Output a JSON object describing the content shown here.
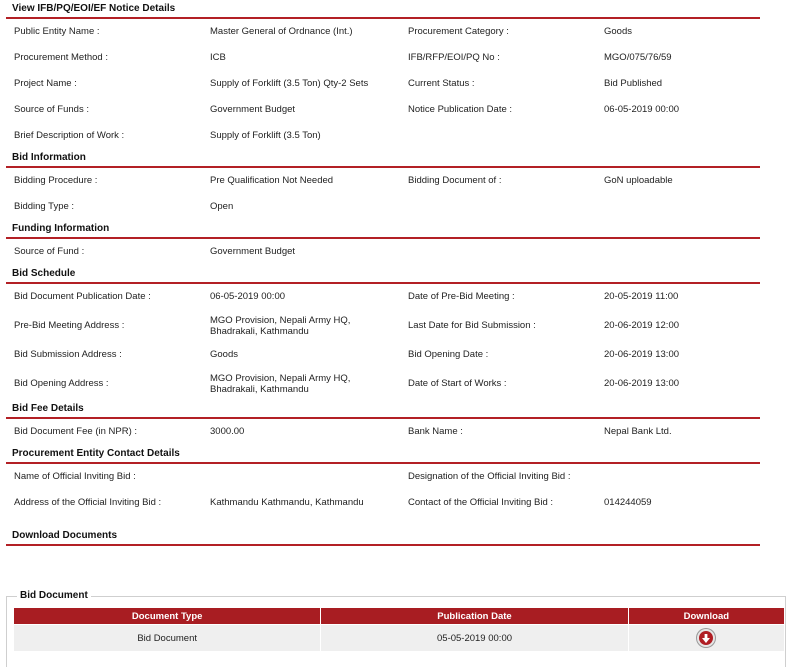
{
  "notice": {
    "title": "View IFB/PQ/EOI/EF Notice Details",
    "rows": [
      [
        "Public Entity Name :",
        "Master General of Ordnance (Int.)",
        "Procurement Category :",
        "Goods"
      ],
      [
        "Procurement Method :",
        "ICB",
        "IFB/RFP/EOI/PQ No :",
        "MGO/075/76/59"
      ],
      [
        "Project Name :",
        "Supply of Forklift (3.5 Ton) Qty-2 Sets",
        "Current Status :",
        "Bid Published"
      ],
      [
        "Source of Funds :",
        "Government Budget",
        "Notice Publication Date :",
        "06-05-2019 00:00"
      ],
      [
        "Brief Description of Work :",
        "Supply of Forklift (3.5 Ton)",
        "",
        ""
      ]
    ]
  },
  "bid_information": {
    "title": "Bid Information",
    "rows": [
      [
        "Bidding Procedure :",
        "Pre Qualification Not Needed",
        "Bidding Document of :",
        "GoN uploadable"
      ],
      [
        "Bidding Type :",
        "Open",
        "",
        ""
      ]
    ]
  },
  "funding_information": {
    "title": "Funding Information",
    "rows": [
      [
        "Source of Fund :",
        "Government Budget",
        "",
        ""
      ]
    ]
  },
  "bid_schedule": {
    "title": "Bid Schedule",
    "rows": [
      [
        "Bid Document Publication Date :",
        "06-05-2019 00:00",
        "Date of Pre-Bid Meeting :",
        "20-05-2019 11:00"
      ],
      [
        "Pre-Bid Meeting Address :",
        "MGO Provision, Nepali Army HQ, Bhadrakali, Kathmandu",
        "Last Date for Bid Submission :",
        "20-06-2019 12:00"
      ],
      [
        "Bid Submission Address :",
        "Goods",
        "Bid Opening Date :",
        "20-06-2019 13:00"
      ],
      [
        "Bid Opening Address :",
        "MGO Provision, Nepali Army HQ, Bhadrakali, Kathmandu",
        "Date of Start of Works :",
        "20-06-2019 13:00"
      ]
    ]
  },
  "bid_fee": {
    "title": "Bid Fee Details",
    "rows": [
      [
        "Bid Document Fee (in NPR) :",
        "3000.00",
        "Bank Name :",
        "Nepal Bank Ltd."
      ]
    ]
  },
  "contact": {
    "title": "Procurement Entity Contact Details",
    "rows": [
      [
        "Name of Official Inviting Bid :",
        "",
        "Designation of the Official Inviting Bid :",
        ""
      ],
      [
        "Address of the Official Inviting Bid :",
        "Kathmandu Kathmandu, Kathmandu",
        "Contact of the Official Inviting Bid :",
        "014244059"
      ]
    ]
  },
  "downloads": {
    "title": "Download Documents",
    "bid_document_legend": "Bid Document",
    "columns": [
      "Document Type",
      "Publication Date",
      "Download"
    ],
    "rows": [
      {
        "type": "Bid Document",
        "date": "05-05-2019 00:00",
        "icon": "download-icon"
      }
    ]
  },
  "colors": {
    "accent": "#b32025",
    "header_bg": "#a81d22",
    "row_bg": "#efefef"
  }
}
